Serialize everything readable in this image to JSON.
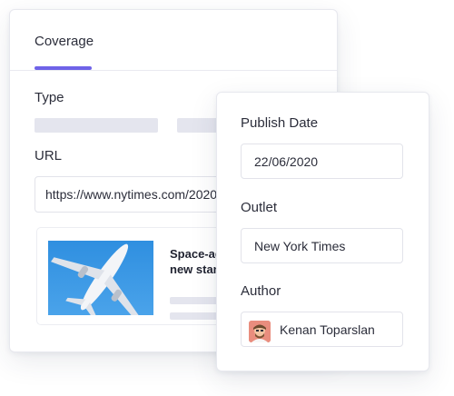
{
  "coverage": {
    "tab_label": "Coverage",
    "type_label": "Type",
    "url_label": "URL",
    "url_value": "https://www.nytimes.com/2020",
    "preview": {
      "title_line1": "Space-ag",
      "title_line2": "new stan",
      "image_icon": "airplane-icon"
    }
  },
  "meta": {
    "publish_date_label": "Publish Date",
    "publish_date_value": "22/06/2020",
    "outlet_label": "Outlet",
    "outlet_value": "New York Times",
    "author_label": "Author",
    "author_value": "Kenan Toparslan"
  },
  "colors": {
    "accent": "#6f63e8",
    "skeleton": "#e4e5ee",
    "sky": "#3a97e4"
  }
}
